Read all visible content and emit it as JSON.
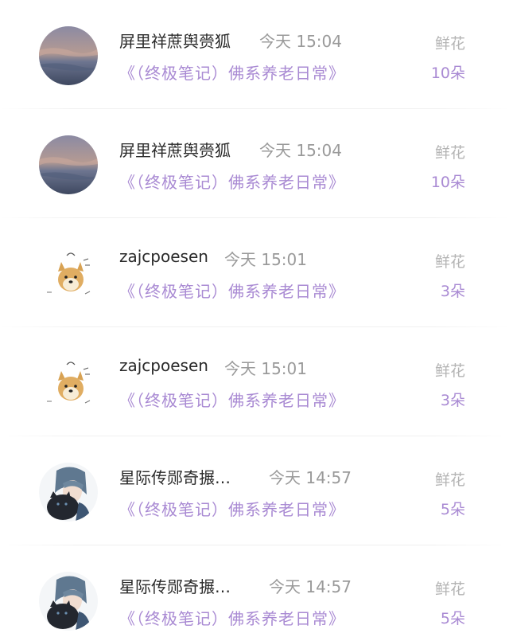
{
  "gifts": [
    {
      "user": "屏里祥蔗舆赍狐",
      "time": "今天 15:04",
      "book": "《（终极笔记）佛系养老日常》",
      "gift_type": "鲜花",
      "count": "10朵",
      "avatar": "lake-landscape"
    },
    {
      "user": "屏里祥蔗舆赍狐",
      "time": "今天 15:04",
      "book": "《（终极笔记）佛系养老日常》",
      "gift_type": "鲜花",
      "count": "10朵",
      "avatar": "lake-landscape"
    },
    {
      "user": "zajcpoesen",
      "time": "今天 15:01",
      "book": "《（终极笔记）佛系养老日常》",
      "gift_type": "鲜花",
      "count": "3朵",
      "avatar": "shiba-doge"
    },
    {
      "user": "zajcpoesen",
      "time": "今天 15:01",
      "book": "《（终极笔记）佛系养老日常》",
      "gift_type": "鲜花",
      "count": "3朵",
      "avatar": "shiba-doge"
    },
    {
      "user": "星际传郧奇搌…",
      "time": "今天 14:57",
      "book": "《（终极笔记）佛系养老日常》",
      "gift_type": "鲜花",
      "count": "5朵",
      "avatar": "anime-boy-with-cat"
    },
    {
      "user": "星际传郧奇搌…",
      "time": "今天 14:57",
      "book": "《（终极笔记）佛系养老日常》",
      "gift_type": "鲜花",
      "count": "5朵",
      "avatar": "anime-boy-with-cat"
    }
  ],
  "colors": {
    "name": "#2a2a2a",
    "meta": "#9a9a9a",
    "accent": "#a98ad3",
    "label": "#b4b4b4"
  }
}
